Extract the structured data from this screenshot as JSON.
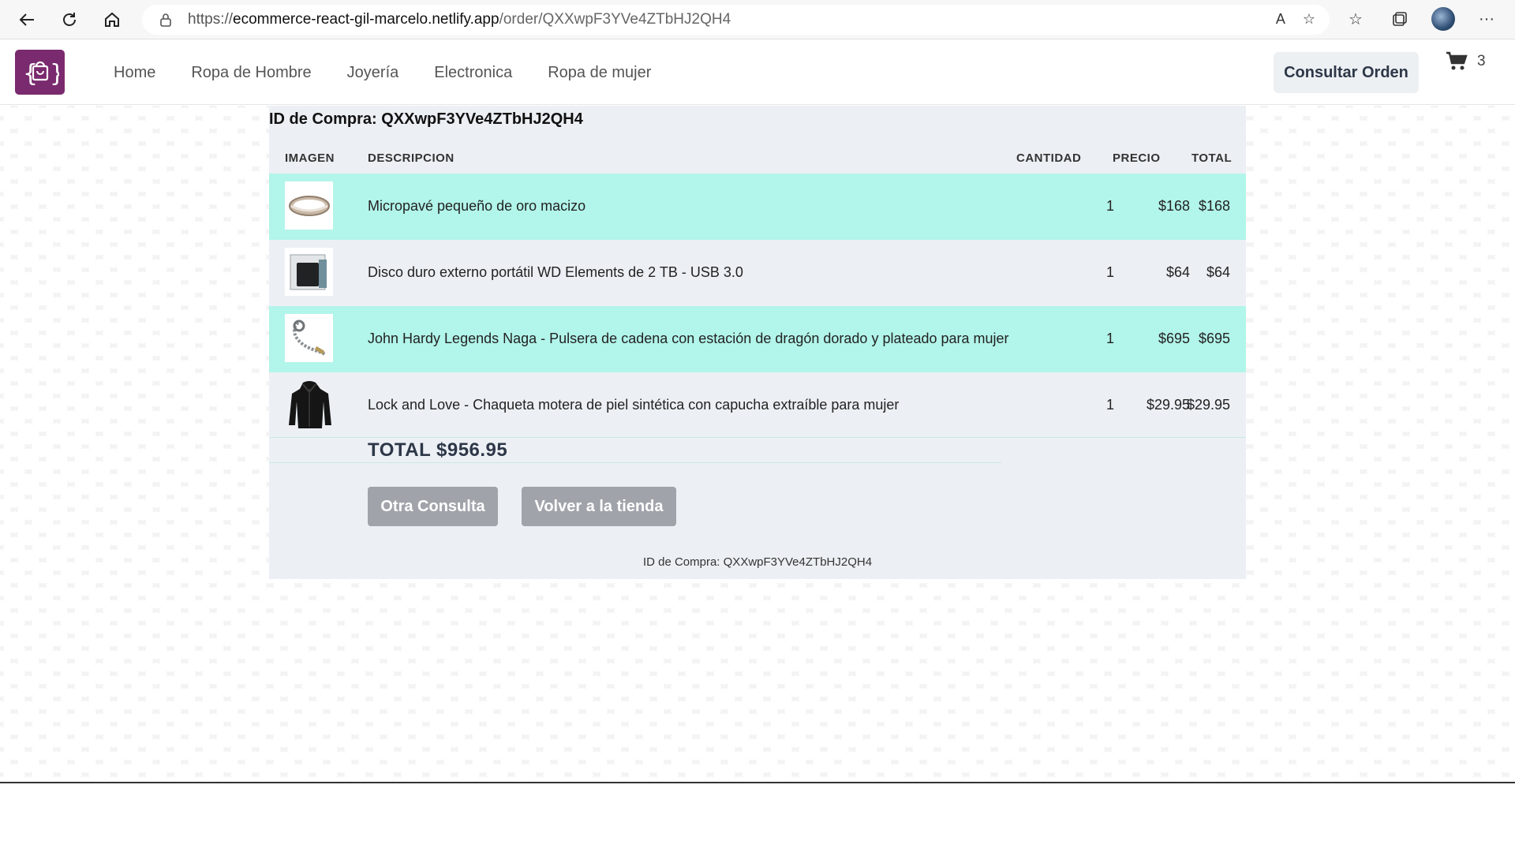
{
  "browser": {
    "url_prefix": "https://",
    "url_host": "ecommerce-react-gil-marcelo.netlify.app",
    "url_path": "/order/QXXwpF3YVe4ZTbHJ2QH4"
  },
  "nav": {
    "items": [
      "Home",
      "Ropa de Hombre",
      "Joyería",
      "Electronica",
      "Ropa de mujer"
    ],
    "consult_button": "Consultar Orden",
    "cart_count": "3"
  },
  "order": {
    "title": "ID de Compra: QXXwpF3YVe4ZTbHJ2QH4",
    "headers": {
      "image": "IMAGEN",
      "description": "DESCRIPCION",
      "quantity": "CANTIDAD",
      "price": "PRECIO",
      "total": "TOTAL"
    },
    "rows": [
      {
        "desc": "Micropavé pequeño de oro macizo",
        "qty": "1",
        "price": "$168",
        "total": "$168",
        "icon": "ring-icon"
      },
      {
        "desc": "Disco duro externo portátil WD Elements de 2 TB - USB 3.0",
        "qty": "1",
        "price": "$64",
        "total": "$64",
        "icon": "hard-drive-icon"
      },
      {
        "desc": "John Hardy Legends Naga - Pulsera de cadena con estación de dragón dorado y plateado para mujer",
        "qty": "1",
        "price": "$695",
        "total": "$695",
        "icon": "bracelet-icon"
      },
      {
        "desc": "Lock and Love - Chaqueta motera de piel sintética con capucha extraíble para mujer",
        "qty": "1",
        "price": "$29.95",
        "total": "$29.95",
        "icon": "jacket-icon"
      }
    ],
    "grand_total": "TOTAL $956.95",
    "btn_other": "Otra Consulta",
    "btn_back": "Volver a la tienda",
    "footer": "ID de Compra: QXXwpF3YVe4ZTbHJ2QH4"
  },
  "colors": {
    "logo": "#7a2a6e",
    "row_highlight": "#b2f5ea",
    "panel_bg": "#ecf0f4",
    "button_gray": "#a0a4aa"
  }
}
